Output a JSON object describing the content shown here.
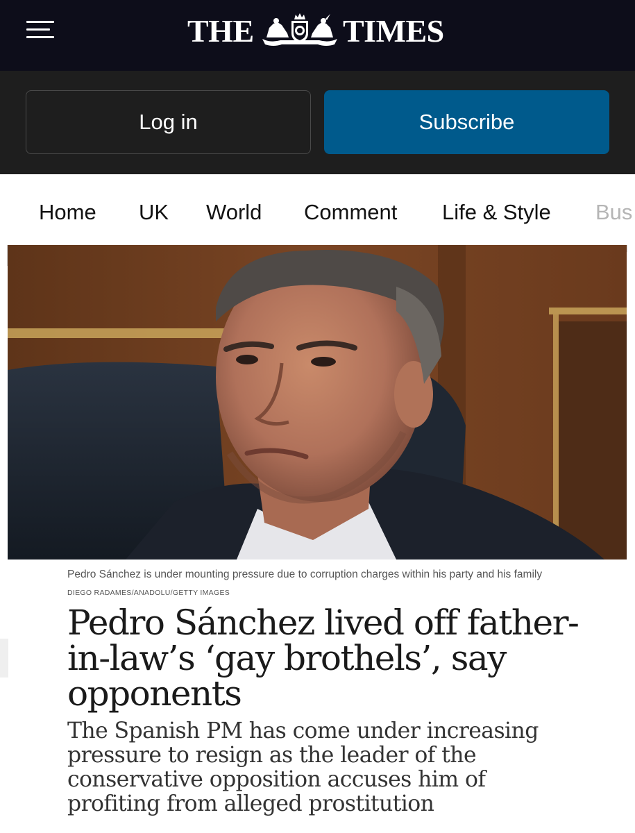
{
  "masthead": {
    "menu_icon": "hamburger-menu-icon",
    "logo_left": "THE",
    "logo_right": "TIMES",
    "crest_icon": "royal-crest-icon",
    "background": "#0d0d1a"
  },
  "auth": {
    "login_label": "Log in",
    "subscribe_label": "Subscribe",
    "subscribe_color": "#005a8c"
  },
  "nav": {
    "items": [
      "Home",
      "UK",
      "World",
      "Comment",
      "Life & Style",
      "Bus"
    ]
  },
  "article": {
    "caption": "Pedro Sánchez is under mounting pressure due to corruption charges within his party and his family",
    "credit": "DIEGO RADAMES/ANADOLU/GETTY IMAGES",
    "headline": "Pedro Sánchez lived off father-in-law’s ‘gay brothels’, say opponents",
    "standfirst": "The Spanish PM has come under increasing pressure to resign as the leader of the conservative opposition accuses him of profiting from alleged prostitution"
  }
}
